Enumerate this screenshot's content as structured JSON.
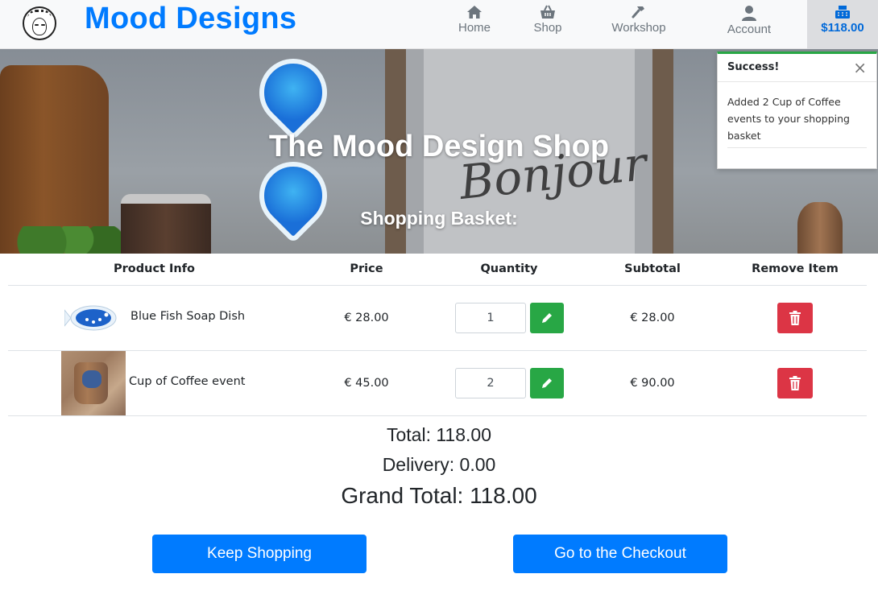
{
  "brand": {
    "name": "Mood Designs"
  },
  "nav": {
    "items": [
      {
        "label": "Home",
        "icon": "home-icon"
      },
      {
        "label": "Shop",
        "icon": "basket-icon"
      },
      {
        "label": "Workshop",
        "icon": "hammer-icon"
      },
      {
        "label": "Account",
        "icon": "user-icon"
      }
    ],
    "cart_total": "$118.00"
  },
  "hero": {
    "title": "The Mood Design Shop",
    "subtitle": "Shopping Basket:"
  },
  "toast": {
    "title": "Success!",
    "close": "×",
    "message": "Added 2 Cup of Coffee events to your shopping basket"
  },
  "table": {
    "headers": [
      "Product Info",
      "Price",
      "Quantity",
      "Subtotal",
      "Remove Item"
    ],
    "rows": [
      {
        "name": "Blue Fish Soap Dish",
        "price": "€ 28.00",
        "quantity": "1",
        "subtotal": "€ 28.00"
      },
      {
        "name": "Cup of Coffee event",
        "price": "€ 45.00",
        "quantity": "2",
        "subtotal": "€ 90.00"
      }
    ]
  },
  "totals": {
    "total": "Total: 118.00",
    "delivery": "Delivery: 0.00",
    "grand_total": "Grand Total: 118.00"
  },
  "actions": {
    "keep_shopping": "Keep Shopping",
    "checkout": "Go to the Checkout"
  },
  "colors": {
    "primary": "#007bff",
    "success": "#28a745",
    "danger": "#dc3545"
  }
}
